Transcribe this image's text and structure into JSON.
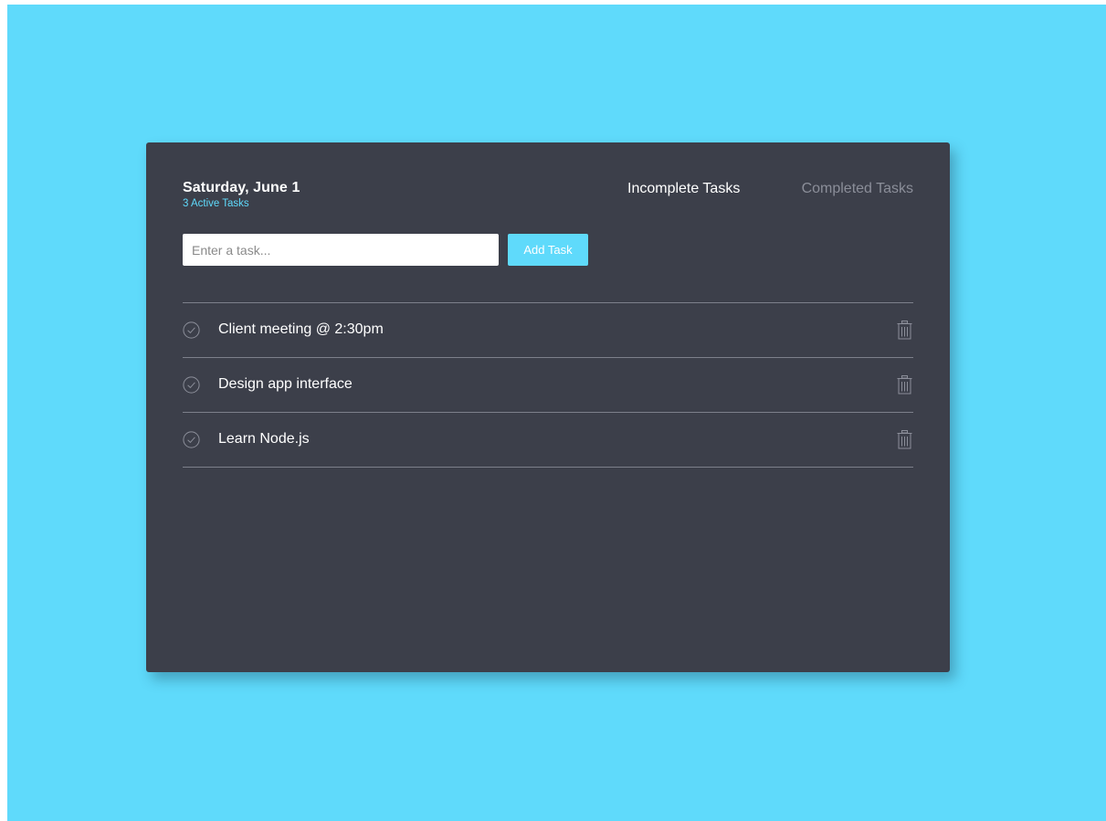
{
  "header": {
    "date": "Saturday, June 1",
    "active_count": "3 Active Tasks"
  },
  "tabs": {
    "incomplete": "Incomplete Tasks",
    "completed": "Completed Tasks"
  },
  "task_input": {
    "placeholder": "Enter a task...",
    "value": ""
  },
  "add_button": {
    "label": "Add Task"
  },
  "tasks": [
    {
      "label": "Client meeting @ 2:30pm",
      "icon": "check-circle-icon",
      "delete_icon": "trash-icon"
    },
    {
      "label": "Design app interface",
      "icon": "check-circle-icon",
      "delete_icon": "trash-icon"
    },
    {
      "label": "Learn Node.js",
      "icon": "check-circle-icon",
      "delete_icon": "trash-icon"
    }
  ],
  "colors": {
    "background": "#5fdafb",
    "card": "#3c3f4a",
    "accent": "#5fdafb",
    "muted_text": "#8b8e99",
    "divider": "#7d808b"
  }
}
